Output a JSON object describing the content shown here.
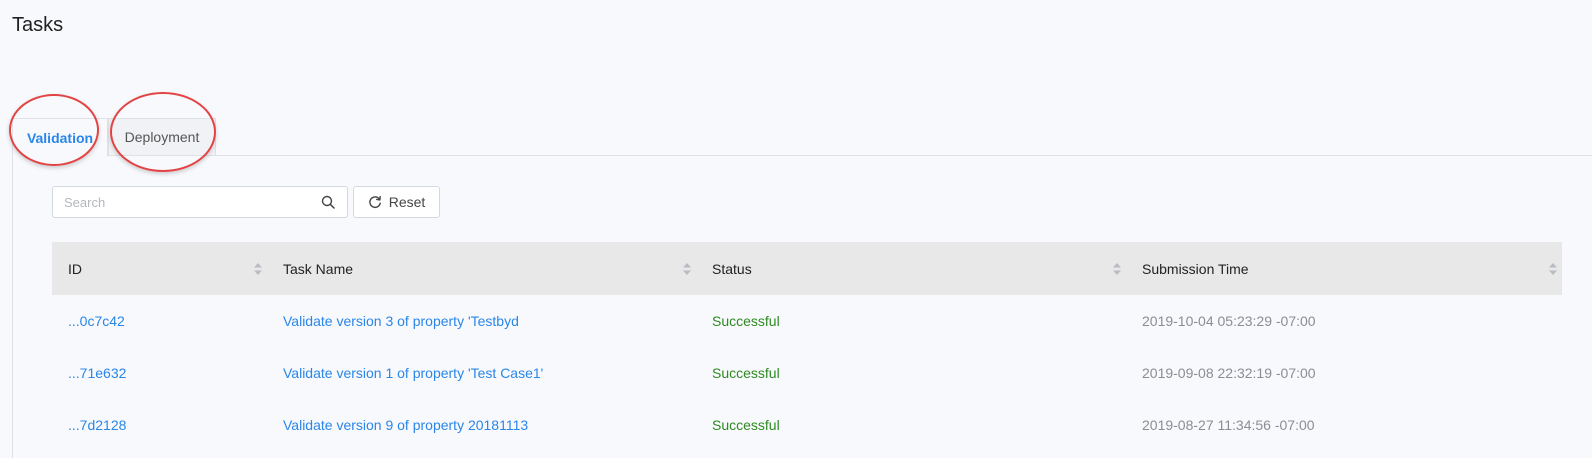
{
  "page": {
    "title": "Tasks"
  },
  "tabs": [
    {
      "label": "Validation",
      "active": true
    },
    {
      "label": "Deployment",
      "active": false
    }
  ],
  "search": {
    "placeholder": "Search",
    "value": ""
  },
  "reset": {
    "label": "Reset"
  },
  "table": {
    "columns": [
      "ID",
      "Task Name",
      "Status",
      "Submission Time"
    ],
    "rows": [
      {
        "id": "...0c7c42",
        "name": "Validate version 3 of property 'Testbyd",
        "status": "Successful",
        "time": "2019-10-04 05:23:29 -07:00"
      },
      {
        "id": "...71e632",
        "name": "Validate version 1 of property 'Test Case1'",
        "status": "Successful",
        "time": "2019-09-08 22:32:19 -07:00"
      },
      {
        "id": "...7d2128",
        "name": "Validate version 9 of property 20181113",
        "status": "Successful",
        "time": "2019-08-27 11:34:56 -07:00"
      }
    ]
  },
  "colors": {
    "accent": "#2a86e8",
    "success": "#2e8a21",
    "highlight_ring": "#e24444",
    "header_bg": "#e8e8e8"
  },
  "icons": {
    "search": "search-icon",
    "reset": "refresh-icon",
    "sort": "sort-icon"
  }
}
